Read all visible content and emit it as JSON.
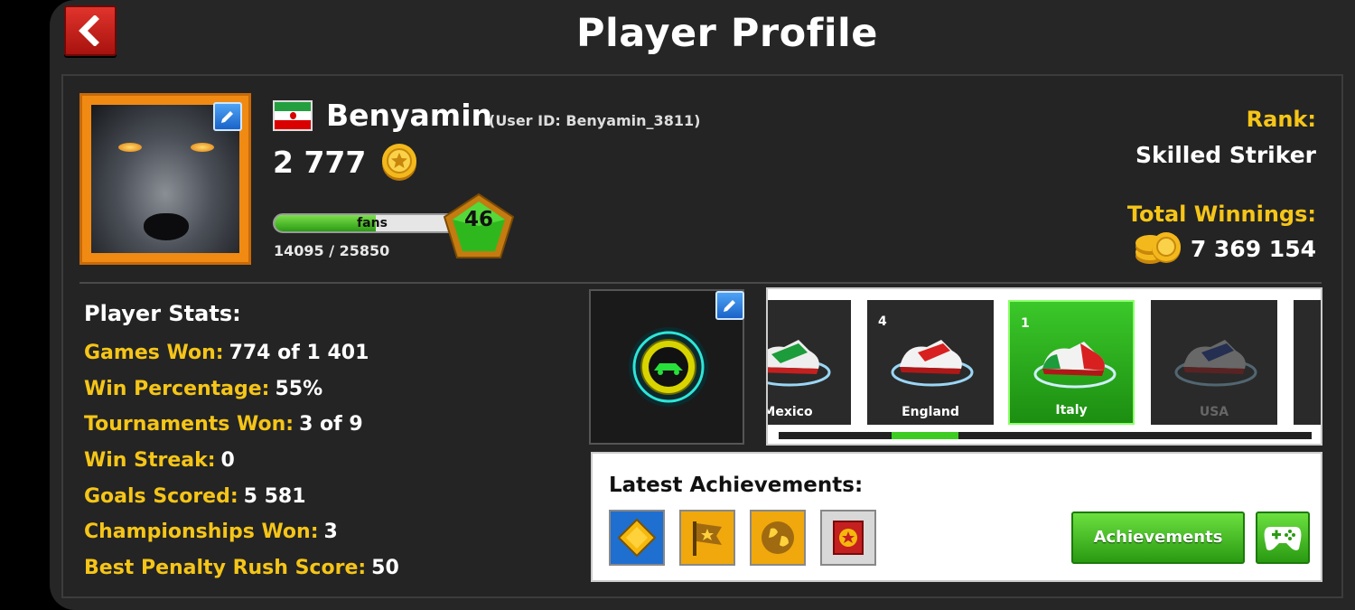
{
  "header": {
    "title": "Player Profile"
  },
  "profile": {
    "name": "Benyamin",
    "user_id": "(User ID: Benyamin_3811)",
    "coins": "2 777",
    "fans_label": "fans",
    "fans_progress": "14095 / 25850",
    "fans_fraction": 0.545,
    "level": "46",
    "country_flag": "Iran"
  },
  "rank": {
    "label": "Rank:",
    "value": "Skilled Striker"
  },
  "winnings": {
    "label": "Total Winnings:",
    "value": "7 369 154"
  },
  "stats": {
    "title": "Player Stats:",
    "items": [
      {
        "label": "Games Won:",
        "value": "774 of 1 401"
      },
      {
        "label": "Win Percentage:",
        "value": "55%"
      },
      {
        "label": "Tournaments Won:",
        "value": "3 of 9"
      },
      {
        "label": "Win Streak:",
        "value": "0"
      },
      {
        "label": "Goals Scored:",
        "value": "5 581"
      },
      {
        "label": "Championships Won:",
        "value": "3"
      },
      {
        "label": "Best Penalty Rush Score:",
        "value": "50"
      }
    ]
  },
  "boots": {
    "items": [
      {
        "count": "",
        "country": "Mexico",
        "selected": false
      },
      {
        "count": "4",
        "country": "England",
        "selected": false
      },
      {
        "count": "1",
        "country": "Italy",
        "selected": true
      },
      {
        "count": "",
        "country": "USA",
        "selected": false
      }
    ]
  },
  "achievements": {
    "title": "Latest Achievements:",
    "button_label": "Achievements",
    "icons": [
      "diamond-badge-icon",
      "star-flag-icon",
      "globe-icon",
      "medal-card-icon"
    ]
  },
  "colors": {
    "accent_yellow": "#f5c518",
    "green": "#2a9a12",
    "back_red": "#d02a22",
    "avatar_frame": "#f08a12"
  }
}
